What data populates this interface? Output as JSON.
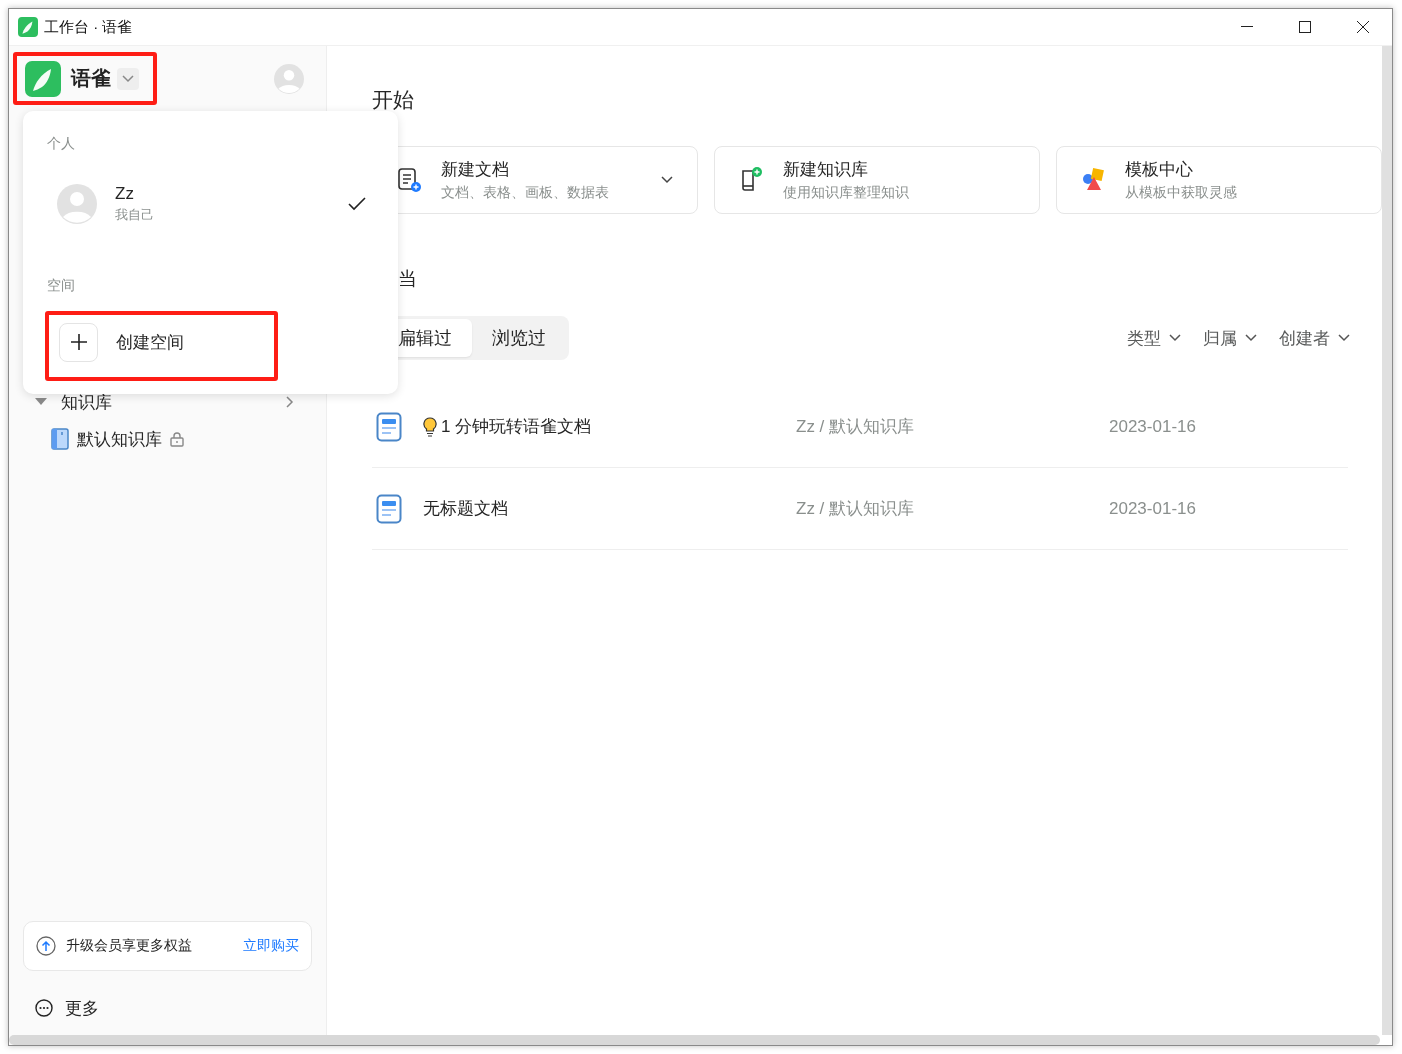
{
  "window": {
    "title": "工作台 · 语雀"
  },
  "sidebar": {
    "brand": "语雀",
    "tree": [
      {
        "label": "知识库",
        "expanded": true,
        "children": [
          {
            "label": "默认知识库",
            "locked": true
          }
        ]
      }
    ],
    "upgrade": {
      "text": "升级会员享更多权益",
      "link": "立即购买"
    },
    "more": "更多"
  },
  "space_menu": {
    "personal_heading": "个人",
    "account": {
      "name": "Zz",
      "subtitle": "我自己",
      "selected": true
    },
    "space_heading": "空间",
    "create_label": "创建空间"
  },
  "main": {
    "start_title": "开始",
    "quick_actions": [
      {
        "kind": "doc",
        "title": "新建文档",
        "subtitle": "文档、表格、画板、数据表",
        "dropdown": true
      },
      {
        "kind": "book",
        "title": "新建知识库",
        "subtitle": "使用知识库整理知识",
        "dropdown": false
      },
      {
        "kind": "template",
        "title": "模板中心",
        "subtitle": "从模板中获取灵感",
        "dropdown": false
      }
    ],
    "docs_title": "当",
    "tabs": [
      {
        "label": "扁辑过",
        "selected": true
      },
      {
        "label": "浏览过",
        "selected": false
      }
    ],
    "filters": [
      "类型",
      "归属",
      "创建者"
    ],
    "documents": [
      {
        "title": "1 分钟玩转语雀文档",
        "tip": true,
        "path": "Zz / 默认知识库",
        "date": "2023-01-16"
      },
      {
        "title": "无标题文档",
        "tip": false,
        "path": "Zz / 默认知识库",
        "date": "2023-01-16"
      }
    ]
  }
}
